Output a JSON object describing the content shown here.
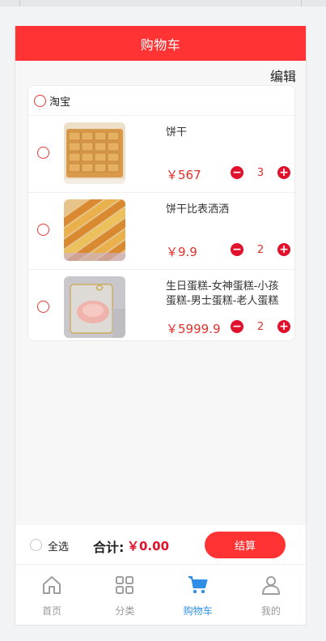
{
  "header": {
    "title": "购物车",
    "edit_label": "编辑"
  },
  "shop": {
    "name": "淘宝"
  },
  "items": [
    {
      "name": "饼干",
      "price": "￥567",
      "qty": "3",
      "image": "cookie-tray-photo"
    },
    {
      "name": "饼干比表洒洒",
      "price": "￥9.9",
      "qty": "2",
      "image": "cookie-rows-photo"
    },
    {
      "name": "生日蛋糕-女神蛋糕-小孩蛋糕-男士蛋糕-老人蛋糕",
      "price": "￥5999.9",
      "qty": "2",
      "image": "cake-photo"
    }
  ],
  "qty_minus": "−",
  "qty_plus": "+",
  "footer": {
    "select_all": "全选",
    "total_label": "合计:",
    "total_value": "￥0.00",
    "checkout_label": "结算"
  },
  "tabs": [
    {
      "label": "首页",
      "icon": "home-icon",
      "active": false
    },
    {
      "label": "分类",
      "icon": "category-icon",
      "active": false
    },
    {
      "label": "购物车",
      "icon": "cart-icon",
      "active": true
    },
    {
      "label": "我的",
      "icon": "user-icon",
      "active": false
    }
  ],
  "colors": {
    "brand_red": "#ff3333",
    "price_red": "#e0312b",
    "active_tab": "#2f8fe6"
  }
}
